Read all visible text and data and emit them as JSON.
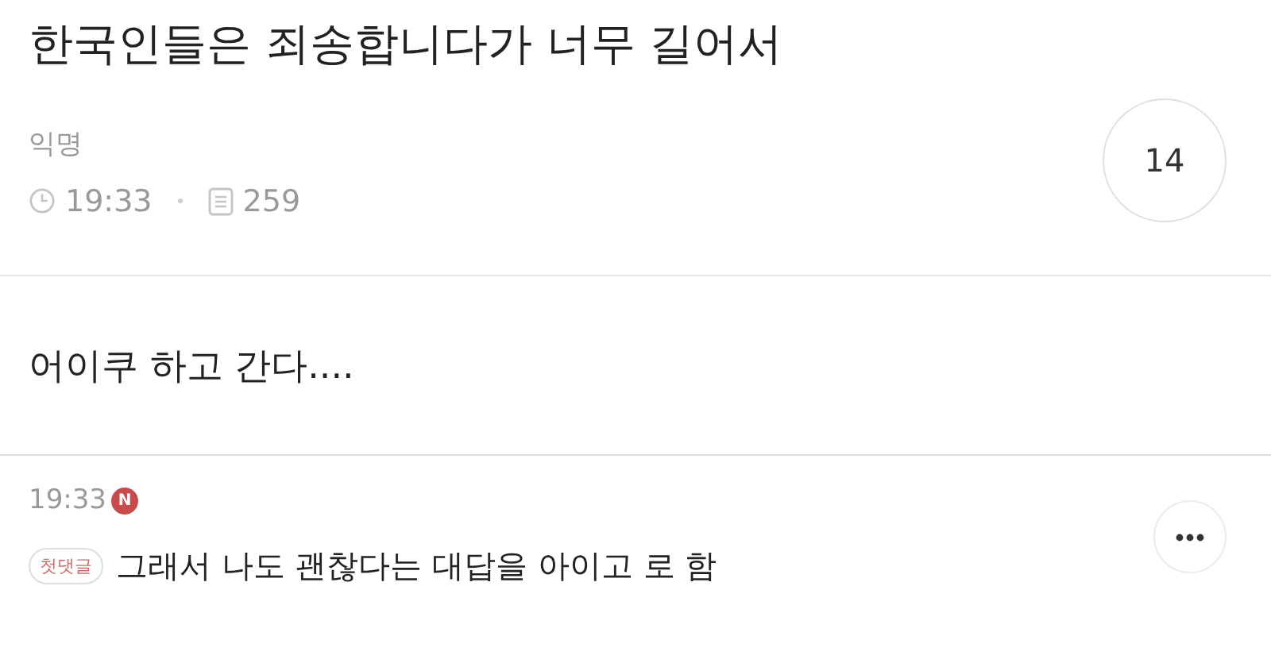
{
  "post": {
    "title": "한국인들은 죄송합니다가 너무 길어서",
    "author": "익명",
    "time": "19:33",
    "views": "259",
    "comment_count": "14",
    "body": "어이쿠 하고 간다...."
  },
  "comments": [
    {
      "time": "19:33",
      "new_badge": "N",
      "is_new": true,
      "tag": "첫댓글",
      "text": "그래서 나도 괜찮다는 대답을 아이고 로 함"
    }
  ]
}
